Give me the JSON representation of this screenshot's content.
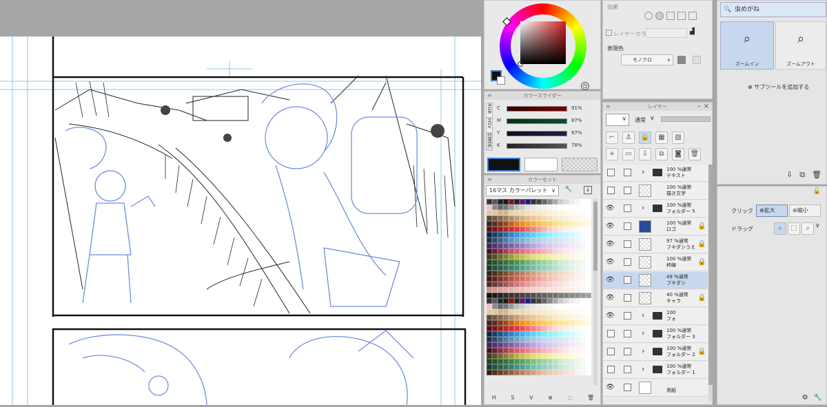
{
  "colors": {
    "accent": "#c7d8ee",
    "sketch_blue": "#6d8ee0",
    "panel_bg": "#e9e9e9"
  },
  "effect": {
    "title": "効果",
    "layer_color_label": "レイヤーカラー",
    "expression_label": "表現色",
    "expression_value": "モノクロ"
  },
  "color_slider": {
    "title": "カラースライダー",
    "modes": [
      "RGB",
      "HSV",
      "CMYK"
    ],
    "rows": [
      {
        "label": "C",
        "value": "91%"
      },
      {
        "label": "M",
        "value": "87%"
      },
      {
        "label": "Y",
        "value": "87%"
      },
      {
        "label": "K",
        "value": "78%"
      }
    ]
  },
  "color_set": {
    "title": "カラーセット",
    "preset": "16マス カラーパレット"
  },
  "layer_panel": {
    "title": "レイヤー",
    "blend_mode": "通常",
    "layers": [
      {
        "opacity": "100 %通常",
        "name": "テキスト",
        "type": "folder",
        "eye": false,
        "lock": false,
        "sel": false
      },
      {
        "opacity": "100 %通常",
        "name": "描き文字",
        "type": "raster",
        "eye": false,
        "lock": false,
        "sel": false
      },
      {
        "opacity": "100 %通常",
        "name": "フォルダー 5",
        "type": "folder",
        "eye": true,
        "lock": false,
        "sel": false
      },
      {
        "opacity": "100 %通常",
        "name": "ロゴ",
        "type": "logo",
        "eye": true,
        "lock": true,
        "sel": false
      },
      {
        "opacity": "97 %通常",
        "name": "フキダシうえ",
        "type": "raster",
        "eye": true,
        "lock": true,
        "sel": false
      },
      {
        "opacity": "100 %通常",
        "name": "枠線",
        "type": "raster",
        "eye": true,
        "lock": true,
        "sel": false
      },
      {
        "opacity": "49 %通常",
        "name": "フキダシ",
        "type": "raster",
        "eye": true,
        "lock": false,
        "sel": true
      },
      {
        "opacity": "40 %通常",
        "name": "キャラ",
        "type": "raster",
        "eye": true,
        "lock": true,
        "sel": false
      },
      {
        "opacity": "100",
        "name": "フォ",
        "type": "folder-check",
        "eye": true,
        "lock": false,
        "sel": false
      },
      {
        "opacity": "100 %通常",
        "name": "フォルダー 3",
        "type": "folder",
        "eye": false,
        "lock": false,
        "sel": false
      },
      {
        "opacity": "100 %通常",
        "name": "フォルダー 2",
        "type": "folder",
        "eye": false,
        "lock": true,
        "sel": false
      },
      {
        "opacity": "100 %通常",
        "name": "フォルダー 1",
        "type": "folder",
        "eye": false,
        "lock": false,
        "sel": false
      },
      {
        "opacity": "",
        "name": "用紙",
        "type": "paper",
        "eye": true,
        "lock": false,
        "sel": false
      }
    ]
  },
  "subtool": {
    "search_value": "虫めがね",
    "zoom_in": "ズームイン",
    "zoom_out": "ズームアウト",
    "add_subtool": "サブツールを追加する"
  },
  "tool_property": {
    "click_label": "クリック",
    "zoom_in_opt": "拡大",
    "zoom_out_opt": "縮小",
    "drag_label": "ドラッグ"
  },
  "bottom_icons": [
    "H",
    "S",
    "V"
  ]
}
